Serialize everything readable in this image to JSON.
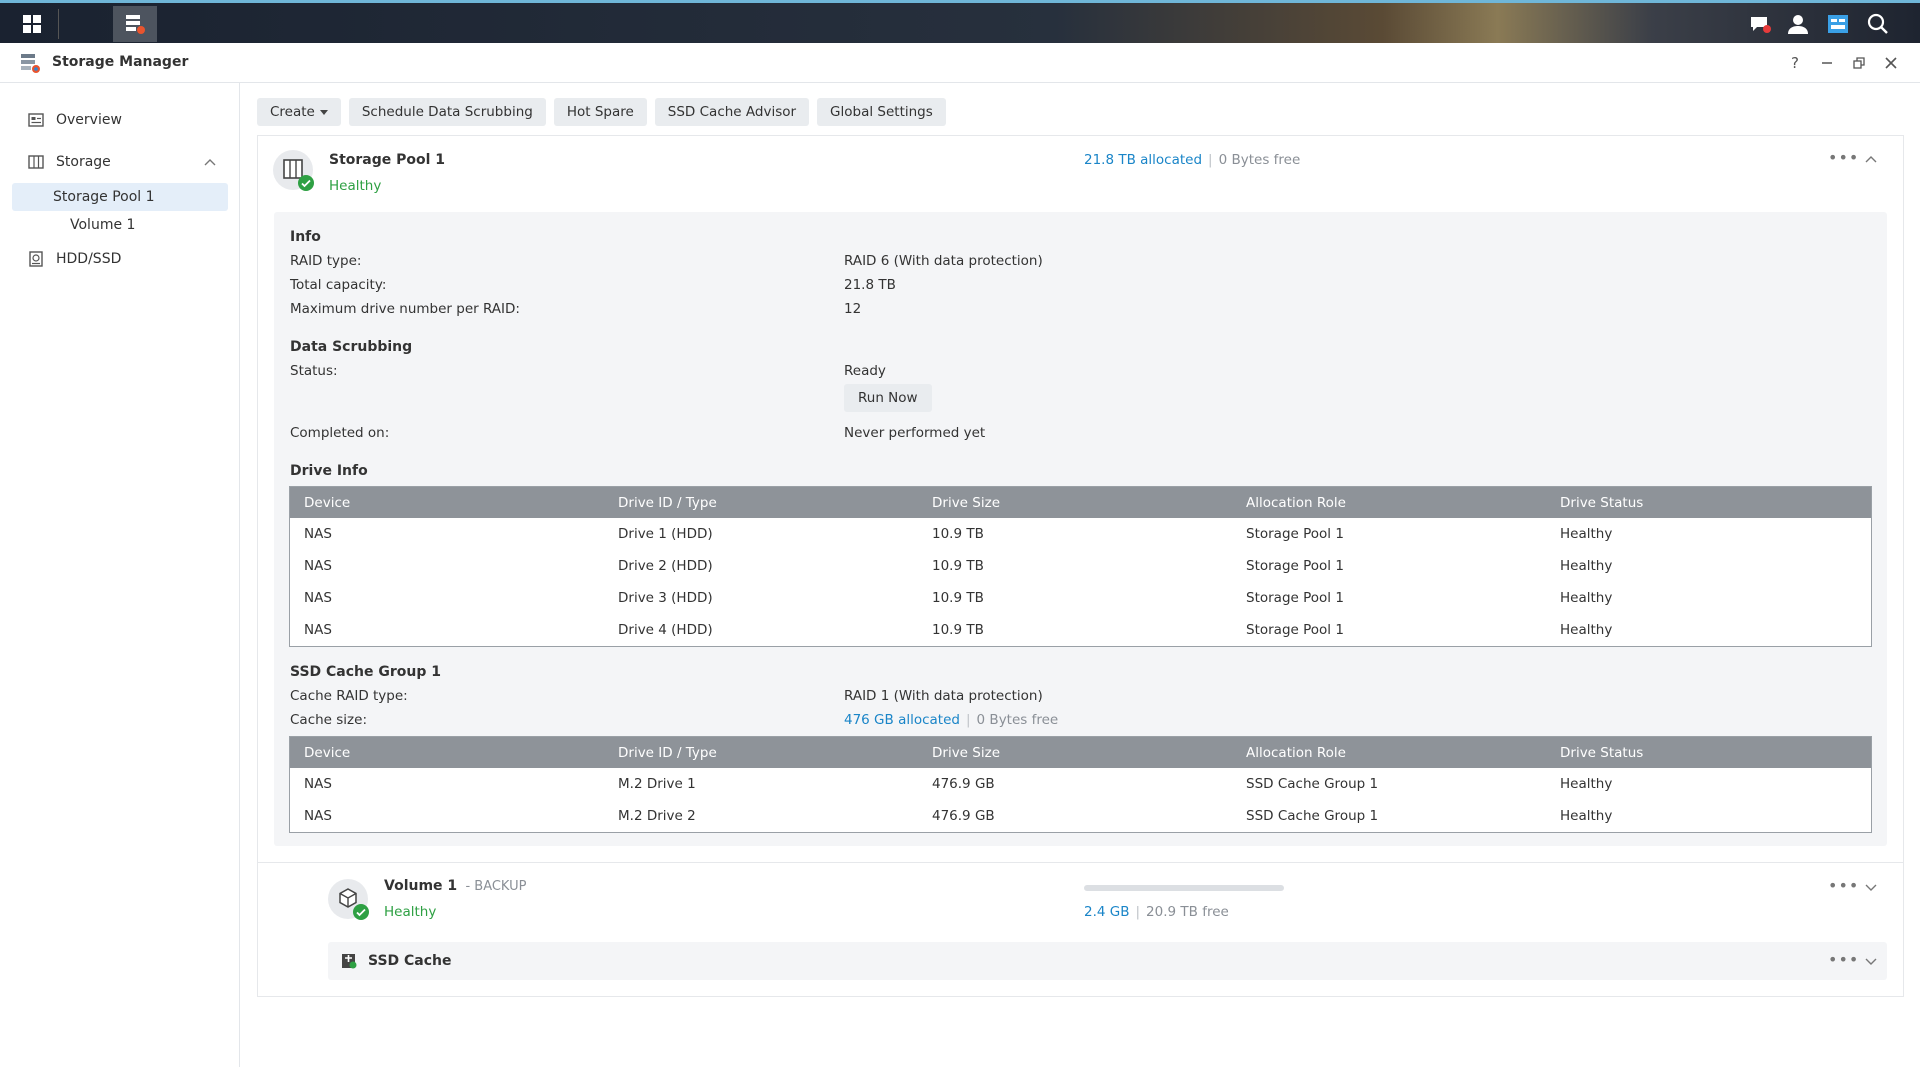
{
  "app": {
    "title": "Storage Manager"
  },
  "sidebar": {
    "items": [
      {
        "label": "Overview"
      },
      {
        "label": "Storage"
      },
      {
        "label": "Storage Pool 1"
      },
      {
        "label": "Volume 1"
      },
      {
        "label": "HDD/SSD"
      }
    ]
  },
  "toolbar": {
    "create": "Create",
    "schedule_scrubbing": "Schedule Data Scrubbing",
    "hot_spare": "Hot Spare",
    "ssd_cache_advisor": "SSD Cache Advisor",
    "global_settings": "Global Settings"
  },
  "pool": {
    "name": "Storage Pool 1",
    "status": "Healthy",
    "allocated": "21.8 TB allocated",
    "free": "0 Bytes free",
    "info": {
      "title": "Info",
      "raid_type_label": "RAID type:",
      "raid_type_value": "RAID 6 (With data protection)",
      "capacity_label": "Total capacity:",
      "capacity_value": "21.8 TB",
      "max_drive_label": "Maximum drive number per RAID:",
      "max_drive_value": "12"
    },
    "scrubbing": {
      "title": "Data Scrubbing",
      "status_label": "Status:",
      "status_value": "Ready",
      "run_now": "Run Now",
      "completed_label": "Completed on:",
      "completed_value": "Never performed yet"
    },
    "drive_info": {
      "title": "Drive Info",
      "columns": [
        "Device",
        "Drive ID / Type",
        "Drive Size",
        "Allocation Role",
        "Drive Status"
      ],
      "rows": [
        [
          "NAS",
          "Drive 1 (HDD)",
          "10.9 TB",
          "Storage Pool 1",
          "Healthy"
        ],
        [
          "NAS",
          "Drive 2 (HDD)",
          "10.9 TB",
          "Storage Pool 1",
          "Healthy"
        ],
        [
          "NAS",
          "Drive 3 (HDD)",
          "10.9 TB",
          "Storage Pool 1",
          "Healthy"
        ],
        [
          "NAS",
          "Drive 4 (HDD)",
          "10.9 TB",
          "Storage Pool 1",
          "Healthy"
        ]
      ]
    },
    "cache_group": {
      "title": "SSD Cache Group 1",
      "raid_label": "Cache RAID type:",
      "raid_value": "RAID 1 (With data protection)",
      "size_label": "Cache size:",
      "allocated": "476 GB allocated",
      "free": "0 Bytes free",
      "columns": [
        "Device",
        "Drive ID / Type",
        "Drive Size",
        "Allocation Role",
        "Drive Status"
      ],
      "rows": [
        [
          "NAS",
          "M.2 Drive 1",
          "476.9 GB",
          "SSD Cache Group 1",
          "Healthy"
        ],
        [
          "NAS",
          "M.2 Drive 2",
          "476.9 GB",
          "SSD Cache Group 1",
          "Healthy"
        ]
      ]
    }
  },
  "volume": {
    "name": "Volume 1",
    "desc": "- BACKUP",
    "status": "Healthy",
    "used": "2.4 GB",
    "free": "20.9 TB free",
    "usage_fraction": 0.0001
  },
  "ssd_cache": {
    "label": "SSD Cache"
  },
  "colors": {
    "healthy": "#2ea043",
    "link": "#1a85c8",
    "table_header": "#8e9399",
    "selected": "#e4eef9"
  }
}
